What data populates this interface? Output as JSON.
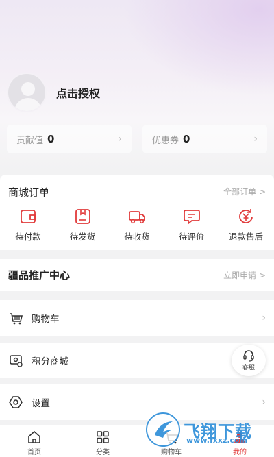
{
  "profile": {
    "name": "点击授权"
  },
  "stats": [
    {
      "label": "贡献值",
      "value": "0"
    },
    {
      "label": "优惠券",
      "value": "0"
    }
  ],
  "orders": {
    "title": "商城订单",
    "all_label": "全部订单 >",
    "items": [
      {
        "label": "待付款",
        "icon": "wallet-icon"
      },
      {
        "label": "待发货",
        "icon": "package-icon"
      },
      {
        "label": "待收货",
        "icon": "truck-icon"
      },
      {
        "label": "待评价",
        "icon": "comment-icon"
      },
      {
        "label": "退款售后",
        "icon": "refund-icon"
      }
    ]
  },
  "promo": {
    "title": "疆品推广中心",
    "link": "立即申请 >"
  },
  "menu": [
    {
      "label": "购物车",
      "icon": "cart-icon"
    },
    {
      "label": "积分商城",
      "icon": "points-icon"
    },
    {
      "label": "设置",
      "icon": "settings-icon"
    }
  ],
  "customer_service": {
    "label": "客服"
  },
  "tabs": [
    {
      "label": "首页",
      "icon": "home-icon"
    },
    {
      "label": "分类",
      "icon": "category-icon"
    },
    {
      "label": "购物车",
      "icon": "cart-icon"
    },
    {
      "label": "我的",
      "icon": "user-icon"
    }
  ],
  "watermark": {
    "text": "飞翔下载",
    "url": "www.fxxz.com"
  },
  "colors": {
    "accent": "#e13a3a",
    "background": "#f2f2f3",
    "watermark": "#2f8fd9"
  }
}
